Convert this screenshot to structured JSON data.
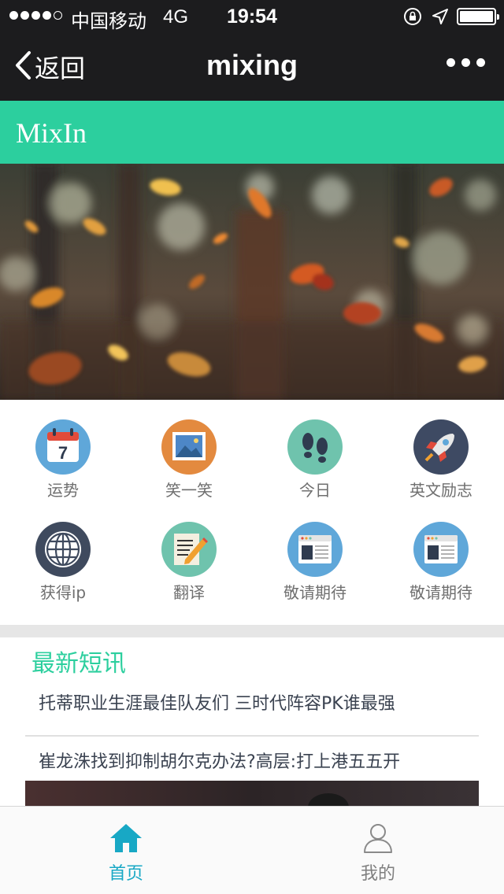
{
  "status_bar": {
    "carrier": "中国移动",
    "network": "4G",
    "time": "19:54"
  },
  "nav": {
    "back_label": "返回",
    "title": "mixing"
  },
  "brand": {
    "title": "MixIn",
    "color": "#2ccf9e"
  },
  "features": [
    {
      "label": "运势",
      "icon": "calendar-icon",
      "color": "#5fa7d9"
    },
    {
      "label": "笑一笑",
      "icon": "picture-icon",
      "color": "#e38a3f"
    },
    {
      "label": "今日",
      "icon": "footprints-icon",
      "color": "#6fc3ad"
    },
    {
      "label": "英文励志",
      "icon": "rocket-icon",
      "color": "#3e4a63"
    },
    {
      "label": "获得ip",
      "icon": "globe-icon",
      "color": "#3f4a5e"
    },
    {
      "label": "翻译",
      "icon": "notepad-pencil-icon",
      "color": "#6fc3ad"
    },
    {
      "label": "敬请期待",
      "icon": "browser-window-icon",
      "color": "#5fa7d9"
    },
    {
      "label": "敬请期待",
      "icon": "browser-window-icon",
      "color": "#5fa7d9"
    }
  ],
  "news": {
    "heading": "最新短讯",
    "items": [
      {
        "title": "托蒂职业生涯最佳队友们 三时代阵容PK谁最强"
      },
      {
        "title": "崔龙洙找到抑制胡尔克办法?高层:打上港五五开"
      }
    ]
  },
  "tab_bar": {
    "tabs": [
      {
        "label": "首页",
        "active": true,
        "icon": "home-icon"
      },
      {
        "label": "我的",
        "active": false,
        "icon": "user-icon"
      }
    ],
    "active_color": "#18a8c5"
  }
}
